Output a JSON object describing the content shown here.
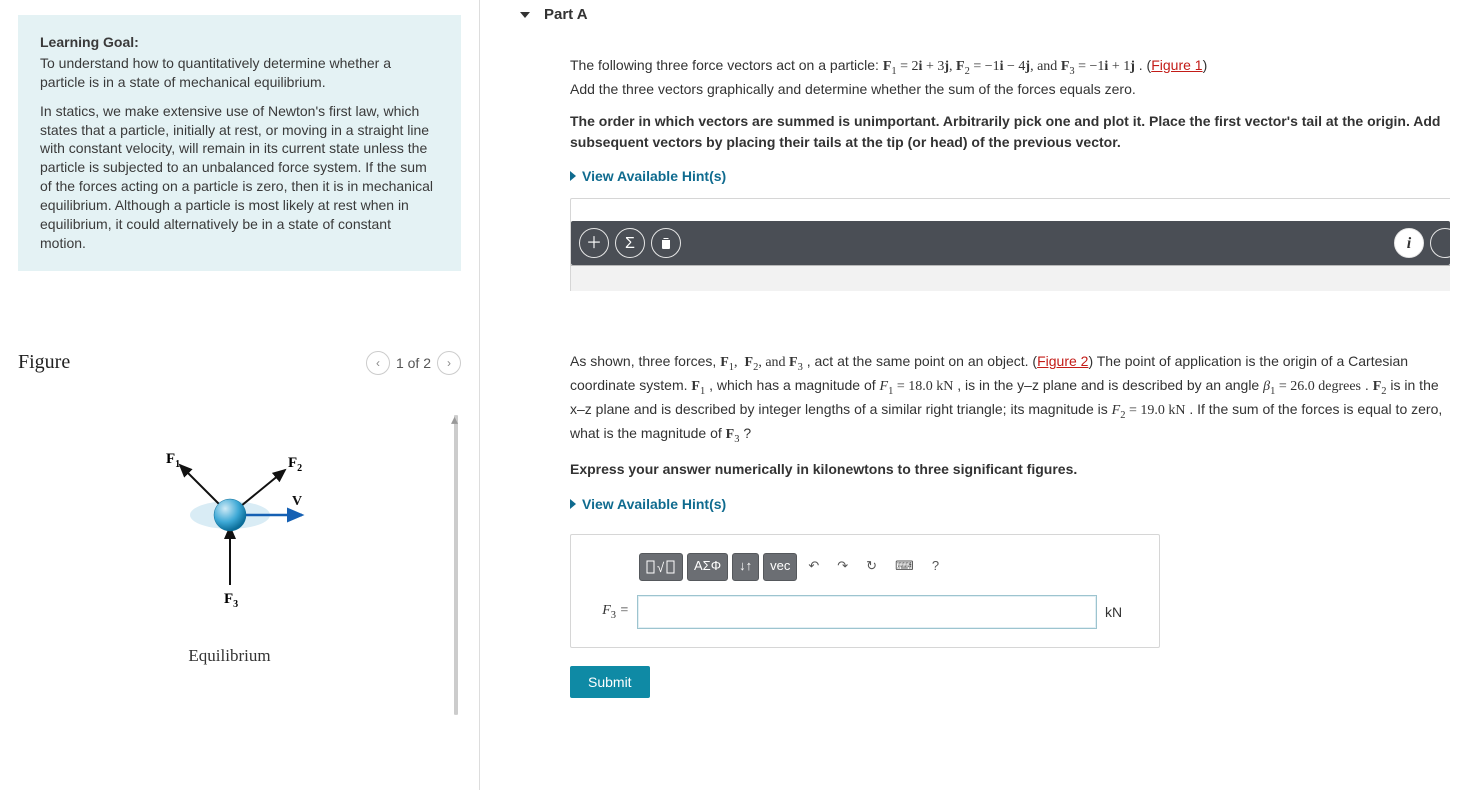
{
  "learning_goal": {
    "heading": "Learning Goal:",
    "intro": "To understand how to quantitatively determine whether a particle is in a state of mechanical equilibrium.",
    "body": "In statics, we make extensive use of Newton's first law, which states that a particle, initially at rest, or moving in a straight line with constant velocity, will remain in its current state unless the particle is subjected to an unbalanced force system. If the sum of the forces acting on a particle is zero, then it is in mechanical equilibrium. Although a particle is most likely at rest when in equilibrium, it could alternatively be in a state of constant motion."
  },
  "figure": {
    "title": "Figure",
    "pager": "1 of 2",
    "labels": {
      "f1": "F",
      "f2": "F",
      "f3": "F",
      "v": "V"
    },
    "caption": "Equilibrium"
  },
  "partA": {
    "title": "Part A",
    "p1_pre": "The following three force vectors act on a particle:  ",
    "p1_math": "F₁ = 2i + 3j, F₂ = −1i − 4j, and F₃ = −1i + 1j",
    "p1_post": ". (",
    "figure1_link": "Figure 1",
    "p1_close": ")",
    "p2": "Add the three vectors graphically and determine whether the sum of the forces equals zero.",
    "p3": "The order in which vectors are summed is unimportant. Arbitrarily pick one and plot it. Place the first vector's tail at the origin. Add subsequent vectors by placing their tails at the tip (or head) of the previous vector.",
    "hints": "View Available Hint(s)"
  },
  "second": {
    "p1a": "As shown, three forces, ",
    "p1b": ", act at the same point on an object. (",
    "figure2_link": "Figure 2",
    "p1c": ") The point of application is the origin of a Cartesian coordinate system. ",
    "p1d": ", which has a magnitude of ",
    "f1mag": "F₁ = 18.0 kN",
    "p1e": " , is in the y–z plane and is described by an angle ",
    "beta": "β₁ = 26.0 degrees",
    "p1f": " . ",
    "p1g": " is in the x–z plane and is described by integer lengths of a similar right triangle; its magnitude is ",
    "f2mag": "F₂ = 19.0 kN",
    "p1h": " .  If the sum of the forces is equal to zero, what is the magnitude of ",
    "p1i": "?",
    "instruct": "Express your answer numerically in kilonewtons to three significant figures.",
    "hints": "View Available Hint(s)",
    "answer_label": "F₃ =",
    "unit": "kN",
    "toolbar": {
      "templates": "▯√▯",
      "greek": "ΑΣΦ",
      "arrows": "↓↑",
      "vec": "vec",
      "undo": "↶",
      "redo": "↷",
      "reset": "↻",
      "keyboard": "⌨",
      "help": "?"
    },
    "submit": "Submit"
  }
}
